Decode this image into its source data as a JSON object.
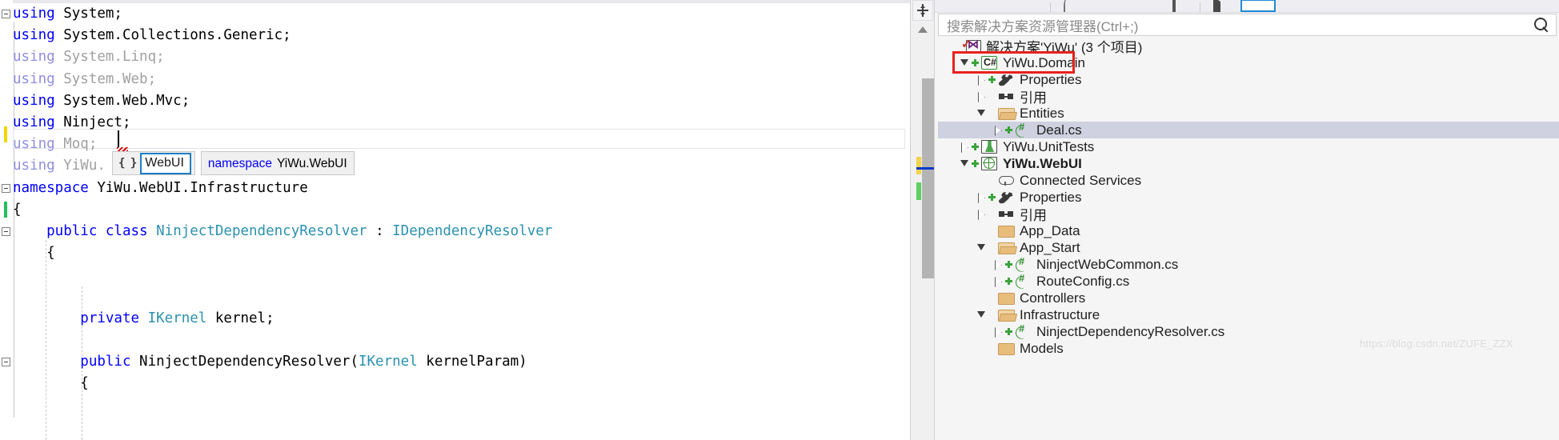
{
  "editor": {
    "lines": [
      {
        "collapse": true,
        "segments": [
          {
            "t": "using ",
            "c": "kw"
          },
          {
            "t": "System;",
            "c": "plain"
          }
        ]
      },
      {
        "collapse": false,
        "segments": [
          {
            "t": "using ",
            "c": "kw"
          },
          {
            "t": "System.Collections.Generic;",
            "c": "plain"
          }
        ]
      },
      {
        "collapse": false,
        "segments": [
          {
            "t": "using ",
            "c": "dim-kw"
          },
          {
            "t": "System.Linq;",
            "c": "dim"
          }
        ]
      },
      {
        "collapse": false,
        "segments": [
          {
            "t": "using ",
            "c": "dim-kw"
          },
          {
            "t": "System.Web;",
            "c": "dim"
          }
        ]
      },
      {
        "collapse": false,
        "segments": [
          {
            "t": "using ",
            "c": "kw"
          },
          {
            "t": "System.Web.Mvc;",
            "c": "plain"
          }
        ]
      },
      {
        "collapse": false,
        "segments": [
          {
            "t": "using ",
            "c": "kw"
          },
          {
            "t": "Ninject;",
            "c": "plain"
          }
        ]
      },
      {
        "collapse": false,
        "segments": [
          {
            "t": "using ",
            "c": "dim-kw"
          },
          {
            "t": "Moq;",
            "c": "dim"
          }
        ]
      },
      {
        "collapse": false,
        "segments": [
          {
            "t": "using ",
            "c": "dim-kw"
          },
          {
            "t": "YiWu.",
            "c": "dim"
          }
        ]
      },
      {
        "collapse": true,
        "segments": [
          {
            "t": "namespace ",
            "c": "kw"
          },
          {
            "t": "YiWu.WebUI.Infrastructure",
            "c": "plain"
          }
        ]
      },
      {
        "collapse": false,
        "segments": [
          {
            "t": "{",
            "c": "plain"
          }
        ]
      },
      {
        "collapse": true,
        "segments": [
          {
            "t": "    public class ",
            "c": "kw"
          },
          {
            "t": "NinjectDependencyResolver",
            "c": "type"
          },
          {
            "t": " : ",
            "c": "plain"
          },
          {
            "t": "IDependencyResolver",
            "c": "type"
          }
        ]
      },
      {
        "collapse": false,
        "segments": [
          {
            "t": "    {",
            "c": "plain"
          }
        ]
      },
      {
        "collapse": false,
        "segments": [
          {
            "t": "",
            "c": "plain"
          }
        ]
      },
      {
        "collapse": false,
        "segments": [
          {
            "t": "",
            "c": "plain"
          }
        ]
      },
      {
        "collapse": false,
        "segments": [
          {
            "t": "        private ",
            "c": "kw"
          },
          {
            "t": "IKernel",
            "c": "type"
          },
          {
            "t": " kernel;",
            "c": "plain"
          }
        ]
      },
      {
        "collapse": false,
        "segments": [
          {
            "t": "",
            "c": "plain"
          }
        ]
      },
      {
        "collapse": true,
        "segments": [
          {
            "t": "        public ",
            "c": "kw"
          },
          {
            "t": "NinjectDependencyResolver(",
            "c": "plain"
          },
          {
            "t": "IKernel",
            "c": "type"
          },
          {
            "t": " kernelParam)",
            "c": "plain"
          }
        ]
      },
      {
        "collapse": false,
        "segments": [
          {
            "t": "        {",
            "c": "plain"
          }
        ]
      }
    ],
    "intellisense": {
      "icon_glyph": "{ }",
      "selected_item": "WebUI",
      "tooltip_keyword": "namespace",
      "tooltip_text": "YiWu.WebUI"
    }
  },
  "scrollbar": {
    "splitter_name": "split-view-control",
    "up_arrow": "scroll-up"
  },
  "solution_explorer": {
    "search": {
      "placeholder": "搜索解决方案资源管理器(Ctrl+;)",
      "value": ""
    },
    "tree": [
      {
        "id": "solution",
        "label": "解决方案'YiWu' (3 个项目)",
        "indent": 0,
        "twisty": "none",
        "plus": false,
        "icon": "solution-icon",
        "bold": false,
        "selected": false,
        "check": true
      },
      {
        "id": "yiwu-domain",
        "label": "YiWu.Domain",
        "indent": 1,
        "twisty": "open",
        "plus": true,
        "icon": "csharp-project-icon",
        "bold": false,
        "selected": false,
        "check": false
      },
      {
        "id": "domain-props",
        "label": "Properties",
        "indent": 2,
        "twisty": "closed",
        "plus": true,
        "icon": "wrench-icon",
        "bold": false,
        "selected": false,
        "check": false
      },
      {
        "id": "domain-refs",
        "label": "引用",
        "indent": 2,
        "twisty": "closed",
        "plus": false,
        "icon": "references-icon",
        "bold": false,
        "selected": false,
        "check": false
      },
      {
        "id": "entities",
        "label": "Entities",
        "indent": 2,
        "twisty": "open",
        "plus": false,
        "icon": "folder-open-icon",
        "bold": false,
        "selected": false,
        "check": false
      },
      {
        "id": "deal-cs",
        "label": "Deal.cs",
        "indent": 3,
        "twisty": "closed",
        "plus": true,
        "icon": "csharp-file-icon",
        "bold": false,
        "selected": true,
        "check": false
      },
      {
        "id": "yiwu-unittests",
        "label": "YiWu.UnitTests",
        "indent": 1,
        "twisty": "closed",
        "plus": true,
        "icon": "test-project-icon",
        "bold": false,
        "selected": false,
        "check": false
      },
      {
        "id": "yiwu-webui",
        "label": "YiWu.WebUI",
        "indent": 1,
        "twisty": "open",
        "plus": true,
        "icon": "web-project-icon",
        "bold": true,
        "selected": false,
        "check": false
      },
      {
        "id": "connected-svc",
        "label": "Connected Services",
        "indent": 2,
        "twisty": "none",
        "plus": false,
        "icon": "cloud-icon",
        "bold": false,
        "selected": false,
        "check": false
      },
      {
        "id": "webui-props",
        "label": "Properties",
        "indent": 2,
        "twisty": "closed",
        "plus": true,
        "icon": "wrench-icon",
        "bold": false,
        "selected": false,
        "check": false
      },
      {
        "id": "webui-refs",
        "label": "引用",
        "indent": 2,
        "twisty": "closed",
        "plus": false,
        "icon": "references-icon",
        "bold": false,
        "selected": false,
        "check": false
      },
      {
        "id": "app-data",
        "label": "App_Data",
        "indent": 2,
        "twisty": "none",
        "plus": false,
        "icon": "folder-icon",
        "bold": false,
        "selected": false,
        "check": false
      },
      {
        "id": "app-start",
        "label": "App_Start",
        "indent": 2,
        "twisty": "open",
        "plus": false,
        "icon": "folder-open-icon",
        "bold": false,
        "selected": false,
        "check": false
      },
      {
        "id": "ninject-web",
        "label": "NinjectWebCommon.cs",
        "indent": 3,
        "twisty": "closed",
        "plus": true,
        "icon": "csharp-file-icon",
        "bold": false,
        "selected": false,
        "check": false
      },
      {
        "id": "route-config",
        "label": "RouteConfig.cs",
        "indent": 3,
        "twisty": "closed",
        "plus": true,
        "icon": "csharp-file-icon",
        "bold": false,
        "selected": false,
        "check": false
      },
      {
        "id": "controllers",
        "label": "Controllers",
        "indent": 2,
        "twisty": "none",
        "plus": false,
        "icon": "folder-icon",
        "bold": false,
        "selected": false,
        "check": false
      },
      {
        "id": "infrastructure",
        "label": "Infrastructure",
        "indent": 2,
        "twisty": "open",
        "plus": false,
        "icon": "folder-open-icon",
        "bold": false,
        "selected": false,
        "check": false
      },
      {
        "id": "ninject-dep",
        "label": "NinjectDependencyResolver.cs",
        "indent": 3,
        "twisty": "closed",
        "plus": true,
        "icon": "csharp-file-icon",
        "bold": false,
        "selected": false,
        "check": false
      },
      {
        "id": "models",
        "label": "Models",
        "indent": 2,
        "twisty": "none",
        "plus": false,
        "icon": "folder-icon",
        "bold": false,
        "selected": false,
        "check": false
      }
    ]
  },
  "watermark": {
    "text": "https://blog.csdn.net/ZUFE_ZZX"
  },
  "colors": {
    "keyword": "#0000ff",
    "type": "#2b91af",
    "highlight_red": "#e8211c",
    "selection": "#cfd1e0",
    "csharp_green": "#2f8f2f"
  }
}
